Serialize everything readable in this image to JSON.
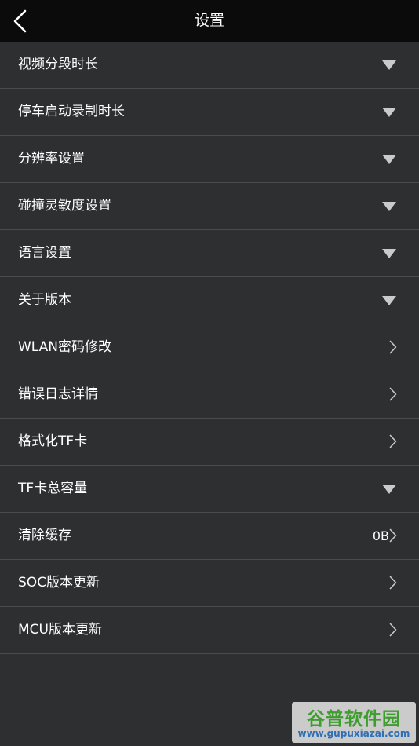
{
  "header": {
    "title": "设置",
    "back_icon": "chevron-left-icon"
  },
  "settings": {
    "items": [
      {
        "label": "视频分段时长",
        "indicator": "dropdown"
      },
      {
        "label": "停车启动录制时长",
        "indicator": "dropdown"
      },
      {
        "label": "分辨率设置",
        "indicator": "dropdown"
      },
      {
        "label": "碰撞灵敏度设置",
        "indicator": "dropdown"
      },
      {
        "label": "语言设置",
        "indicator": "dropdown"
      },
      {
        "label": "关于版本",
        "indicator": "dropdown"
      },
      {
        "label": "WLAN密码修改",
        "indicator": "chevron"
      },
      {
        "label": "错误日志详情",
        "indicator": "chevron"
      },
      {
        "label": "格式化TF卡",
        "indicator": "chevron"
      },
      {
        "label": "TF卡总容量",
        "indicator": "dropdown"
      },
      {
        "label": "清除缓存",
        "indicator": "chevron",
        "value": "0B"
      },
      {
        "label": "SOC版本更新",
        "indicator": "chevron"
      },
      {
        "label": "MCU版本更新",
        "indicator": "chevron"
      }
    ]
  },
  "watermark": {
    "logo_text": "谷普软件园",
    "url": "www.gupuxiazai.com"
  },
  "colors": {
    "topbar_bg": "#0b0b0b",
    "list_bg": "#2e2f31",
    "divider": "#4a4b4d",
    "text": "#ffffff",
    "icon": "#c9cacb"
  }
}
